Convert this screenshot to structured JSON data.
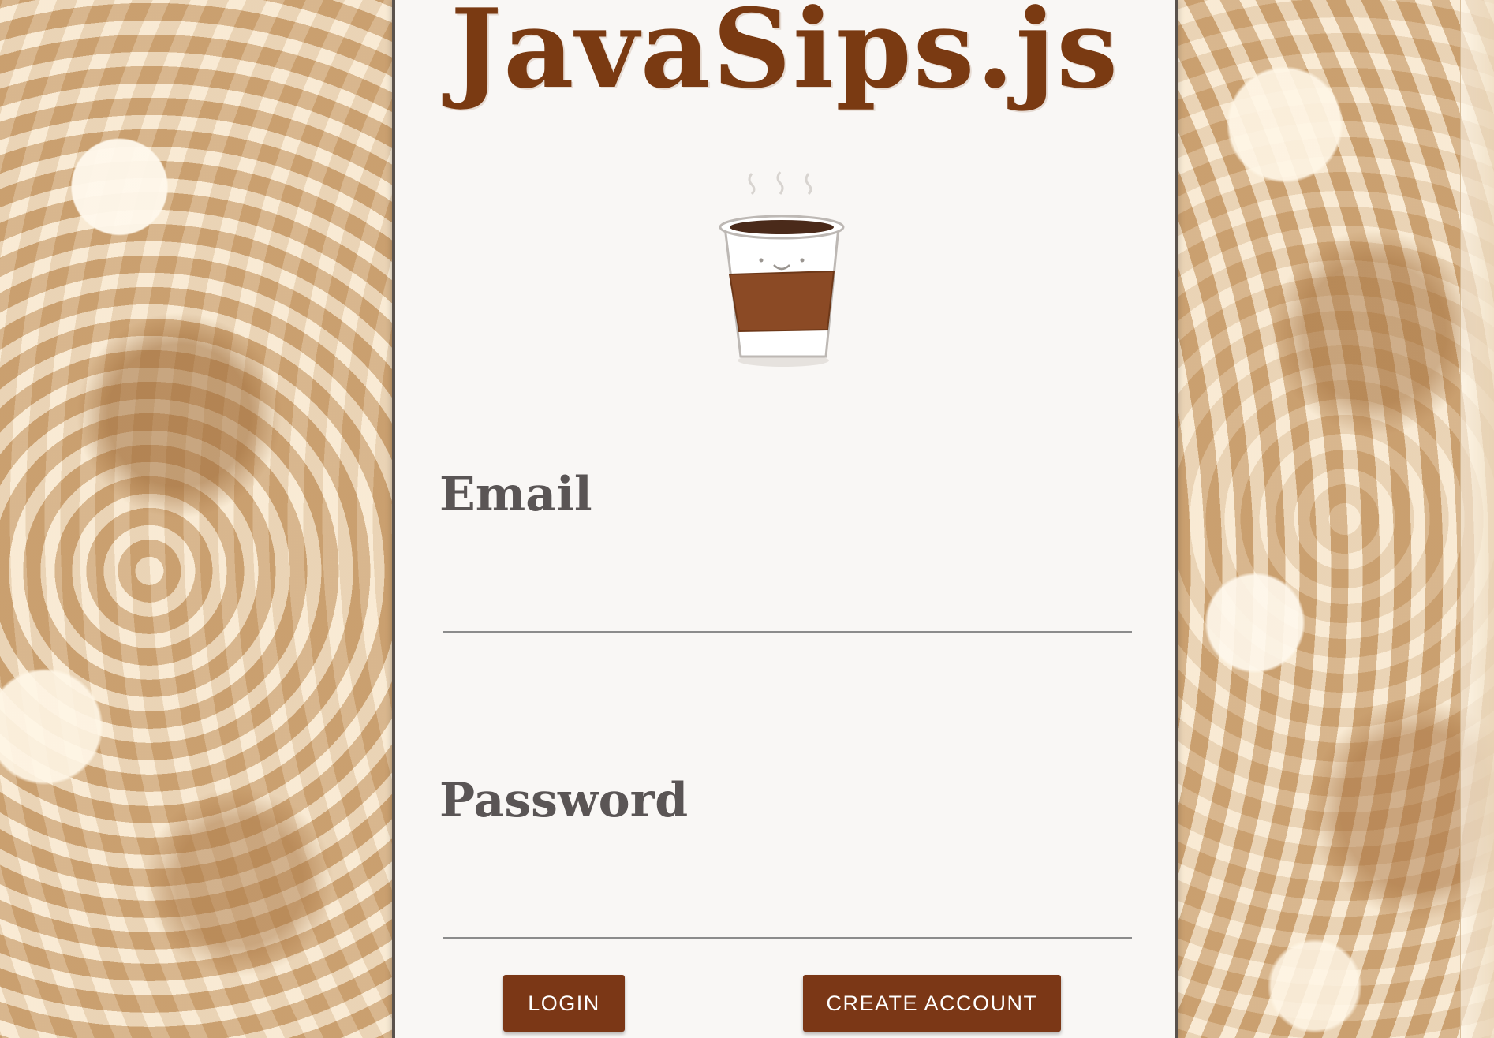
{
  "app": {
    "title": "JavaSips.js"
  },
  "logo": {
    "icon": "coffee-cup-icon",
    "cup_color": "#ffffff",
    "sleeve_color": "#8b4a25",
    "coffee_color": "#4a2a1a"
  },
  "form": {
    "email": {
      "label": "Email",
      "value": "",
      "placeholder": ""
    },
    "password": {
      "label": "Password",
      "value": "",
      "placeholder": ""
    }
  },
  "actions": {
    "login_label": "LOGIN",
    "create_account_label": "CREATE ACCOUNT"
  },
  "colors": {
    "accent": "#7b3716",
    "title": "#7a3a12",
    "label": "#5a5555",
    "panel_bg": "#f9f7f5",
    "panel_border": "#5a524c"
  }
}
